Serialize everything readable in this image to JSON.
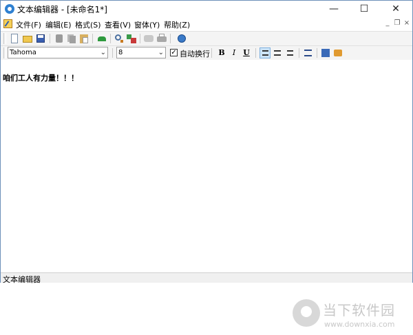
{
  "window": {
    "title": "文本编辑器 - [未命名1*]",
    "minimize_glyph": "—",
    "maximize_glyph": "☐",
    "close_glyph": "✕"
  },
  "menu": {
    "items": [
      {
        "label": "文件(F)"
      },
      {
        "label": "编辑(E)"
      },
      {
        "label": "格式(S)"
      },
      {
        "label": "查看(V)"
      },
      {
        "label": "窗体(Y)"
      },
      {
        "label": "帮助(Z)"
      }
    ],
    "mdi_min": "_",
    "mdi_restore": "❐",
    "mdi_close": "×"
  },
  "toolbar": {
    "icons": [
      "new-file-icon",
      "open-folder-icon",
      "save-icon",
      "cut-icon",
      "copy-icon",
      "paste-icon",
      "undo-icon",
      "find-icon",
      "replace-icon",
      "print-preview-icon",
      "print-icon",
      "help-icon"
    ]
  },
  "format_bar": {
    "font_name": "Tahoma",
    "font_size": "8",
    "word_wrap_label": "自动换行",
    "word_wrap_checked": true,
    "bold": "B",
    "italic": "I",
    "underline": "U",
    "align_left_active": true,
    "extra_icons": [
      "bullet-list-icon",
      "insert-text-icon",
      "color-icon"
    ]
  },
  "editor": {
    "content": "咱们工人有力量！！！"
  },
  "statusbar": {
    "text": "文本编辑器"
  },
  "watermark": {
    "cn": "当下软件园",
    "url": "www.downxia.com"
  },
  "colors": {
    "accent": "#2f80d1",
    "active_button": "#cde4f7"
  }
}
